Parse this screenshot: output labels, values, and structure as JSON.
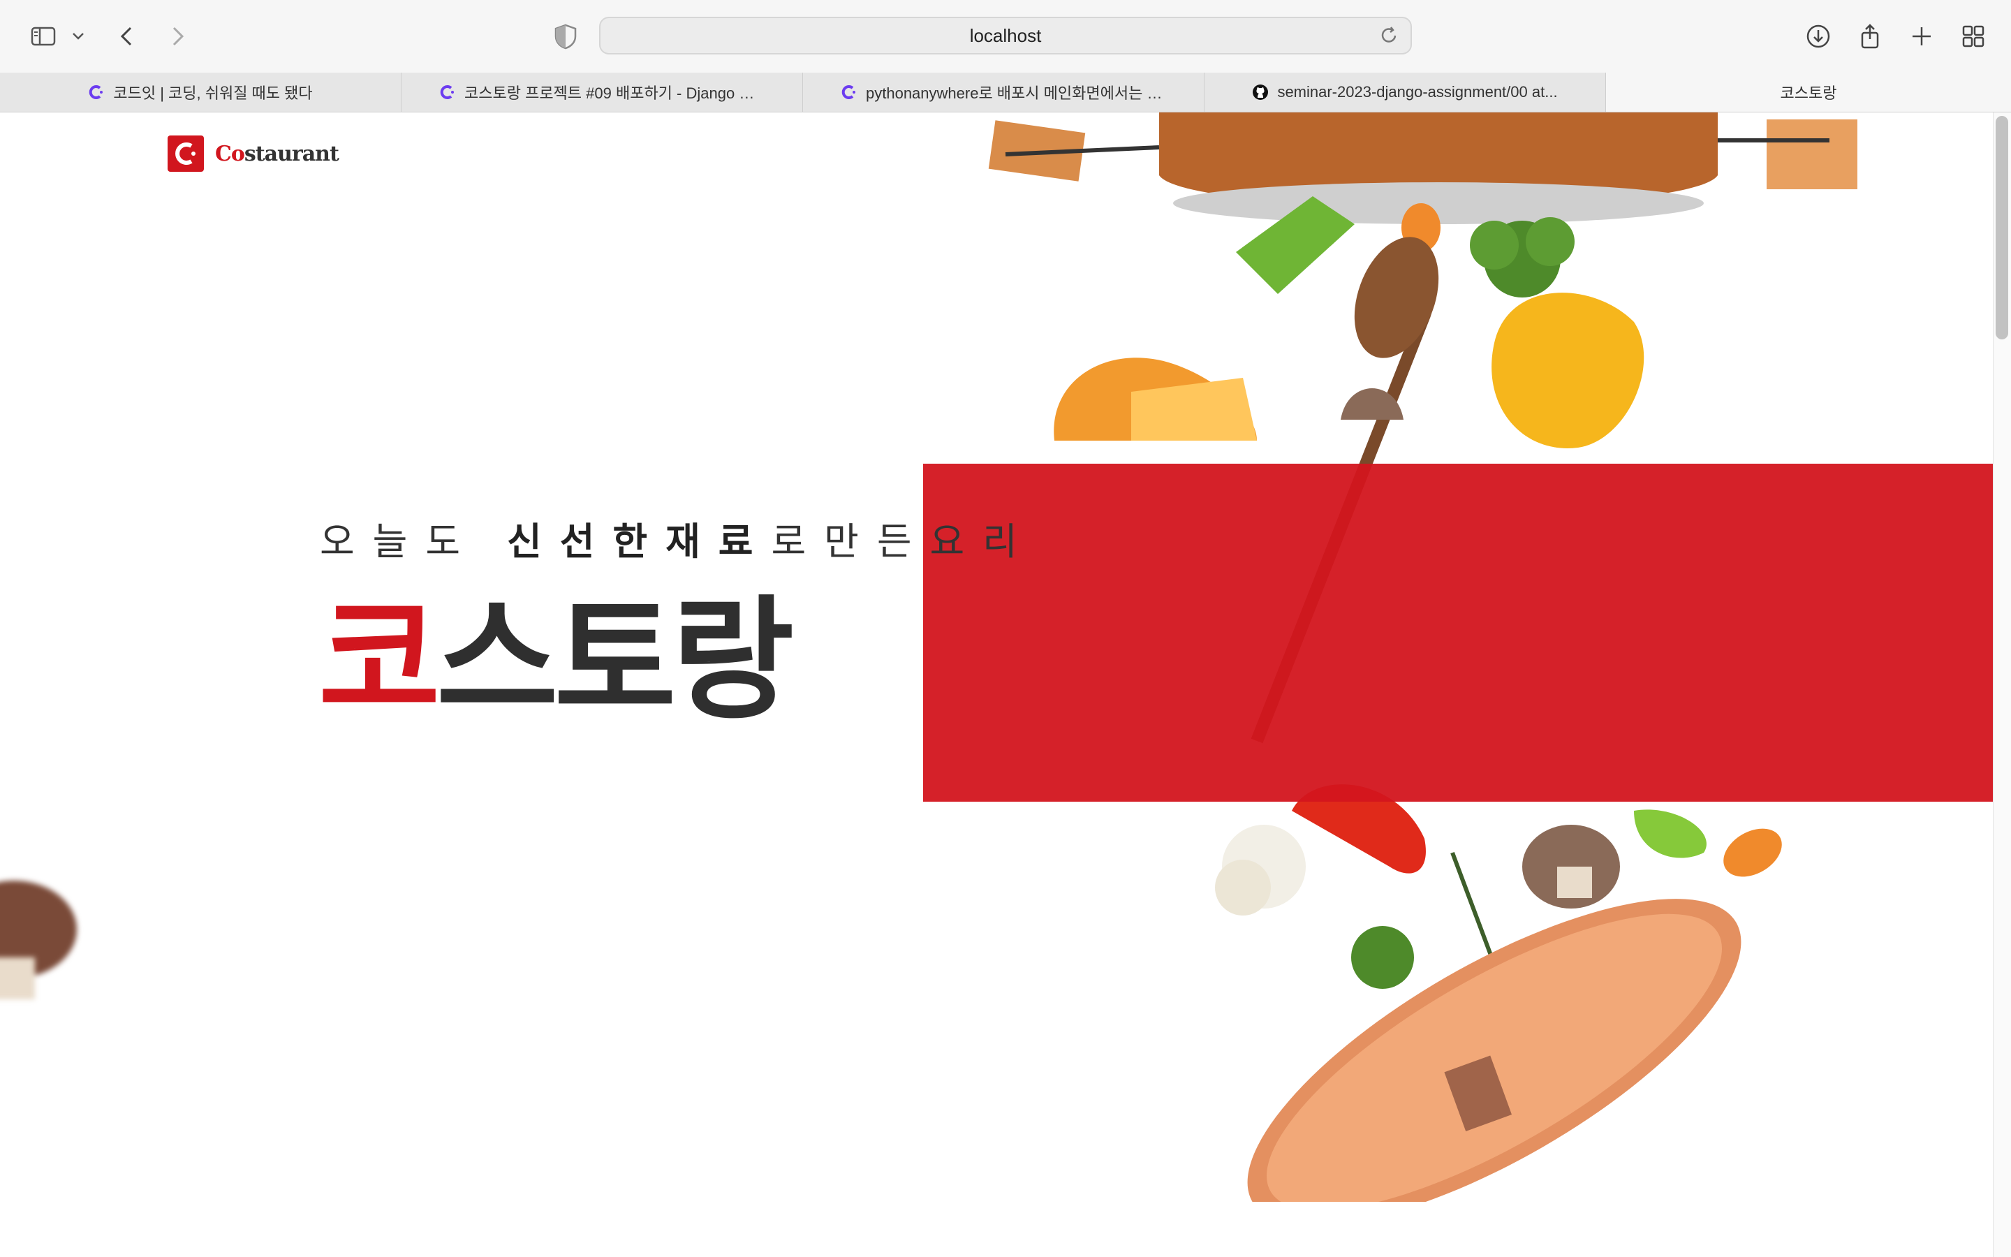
{
  "browser": {
    "url": "localhost",
    "tabs": [
      {
        "label": "코드잇 | 코딩, 쉬워질 때도 됐다",
        "favicon": "codeit-icon"
      },
      {
        "label": "코스토랑 프로젝트 #09 배포하기 - Django 웹...",
        "favicon": "codeit-icon"
      },
      {
        "label": "pythonanywhere로 배포시 메인화면에서는 사...",
        "favicon": "codeit-icon"
      },
      {
        "label": "seminar-2023-django-assignment/00 at...",
        "favicon": "github-icon"
      },
      {
        "label": "코스토랑",
        "favicon": ""
      }
    ]
  },
  "page": {
    "logo": {
      "prefix": "Co",
      "rest": "staurant"
    },
    "subtitle": {
      "pre": "오늘도 ",
      "bold": "신선한재료",
      "post": "로만든요리"
    },
    "hero": {
      "first": "코",
      "rest": "스토랑"
    }
  },
  "colors": {
    "brand_red": "#d1161e",
    "dark_text": "#2f2f2f"
  }
}
